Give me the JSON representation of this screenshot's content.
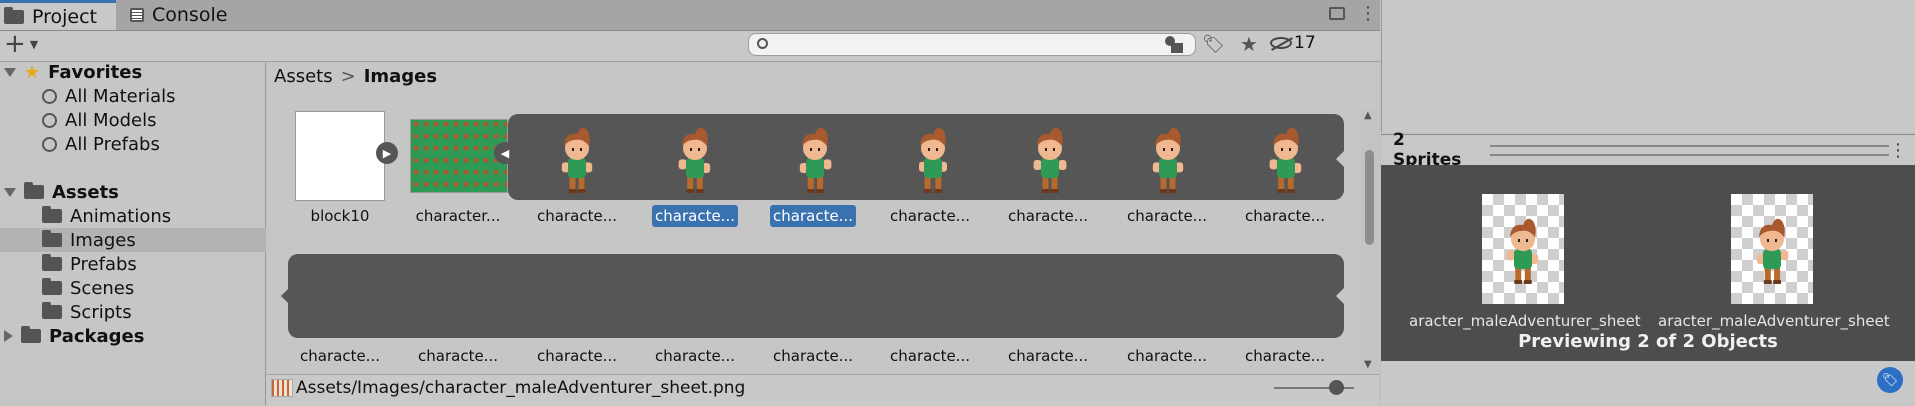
{
  "tabs": {
    "project": "Project",
    "console": "Console"
  },
  "toolbar": {
    "add_label": "+",
    "hidden_count": "17",
    "search_placeholder": ""
  },
  "sidebar": {
    "favorites": "Favorites",
    "fav_items": [
      "All Materials",
      "All Models",
      "All Prefabs"
    ],
    "assets": "Assets",
    "asset_items": [
      "Animations",
      "Images",
      "Prefabs",
      "Scenes",
      "Scripts"
    ],
    "packages": "Packages"
  },
  "breadcrumb": {
    "root": "Assets",
    "sep": ">",
    "current": "Images"
  },
  "grid": {
    "row1": [
      "block10",
      "character...",
      "characte...",
      "characte...",
      "characte...",
      "characte...",
      "characte...",
      "characte...",
      "characte..."
    ],
    "row2": [
      "characte...",
      "characte...",
      "characte...",
      "characte...",
      "characte...",
      "characte...",
      "characte...",
      "characte...",
      "characte..."
    ]
  },
  "status": {
    "path": "Assets/Images/character_maleAdventurer_sheet.png",
    "zoom": 0.85
  },
  "inspector": {
    "title": "2 Sprites",
    "sprite_name": "aracter_maleAdventurer_sheet",
    "footer": "Previewing 2 of 2 Objects"
  },
  "colors": {
    "selection": "#3a72b0",
    "strip": "#565656",
    "skin": "#f0b890",
    "hair": "#a85a2e",
    "shirt": "#2e9a55",
    "pants": "#b86a2c"
  }
}
